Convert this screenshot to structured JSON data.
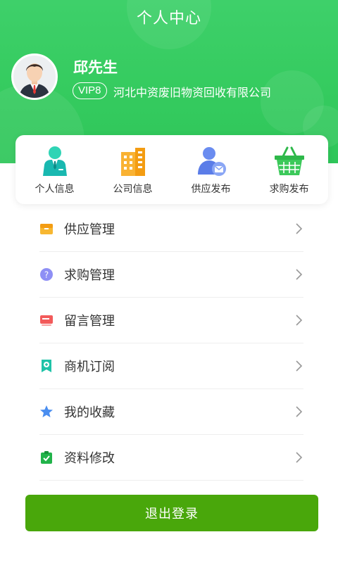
{
  "header": {
    "title": "个人中心"
  },
  "profile": {
    "name": "邱先生",
    "vip_level": "VIP8",
    "company": "河北中资废旧物资回收有限公司"
  },
  "quick_actions": [
    {
      "label": "个人信息",
      "icon": "person-icon"
    },
    {
      "label": "公司信息",
      "icon": "building-icon"
    },
    {
      "label": "供应发布",
      "icon": "user-mail-icon"
    },
    {
      "label": "求购发布",
      "icon": "basket-icon"
    }
  ],
  "menu": [
    {
      "label": "供应管理",
      "icon": "box-icon"
    },
    {
      "label": "求购管理",
      "icon": "question-bubble-icon"
    },
    {
      "label": "留言管理",
      "icon": "message-card-icon"
    },
    {
      "label": "商机订阅",
      "icon": "subscription-icon"
    },
    {
      "label": "我的收藏",
      "icon": "star-icon"
    },
    {
      "label": "资料修改",
      "icon": "clipboard-check-icon"
    }
  ],
  "logout_label": "退出登录",
  "colors": {
    "header_green": "#3ed06a",
    "button_green": "#49a70b"
  }
}
